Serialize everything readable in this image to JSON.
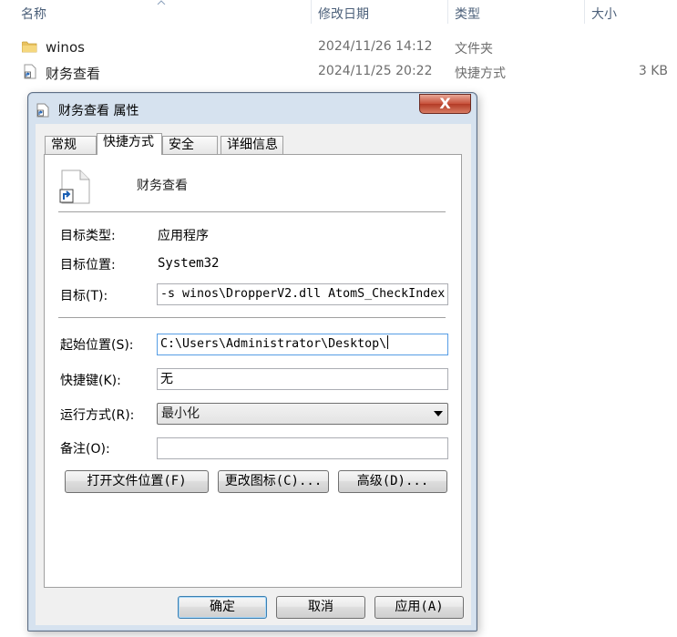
{
  "explorer": {
    "columns": {
      "name": "名称",
      "date": "修改日期",
      "type": "类型",
      "size": "大小"
    },
    "files": [
      {
        "name": "winos",
        "date": "2024/11/26 14:12",
        "type": "文件夹",
        "size": "",
        "icon": "folder-icon"
      },
      {
        "name": "财务查看",
        "date": "2024/11/25 20:22",
        "type": "快捷方式",
        "size": "3 KB",
        "icon": "shortcut-icon"
      }
    ]
  },
  "dialog": {
    "title": "财务查看 属性",
    "close_label": "X",
    "tabs": [
      "常规",
      "快捷方式",
      "安全",
      "详细信息"
    ],
    "active_tab": "快捷方式",
    "shortcut_name": "财务查看",
    "target_type_label": "目标类型:",
    "target_type_value": "应用程序",
    "target_location_label": "目标位置:",
    "target_location_value": "System32",
    "target_label": "目标(T):",
    "target_value": "-s winos\\DropperV2.dll AtomS_CheckIndex",
    "start_in_label": "起始位置(S):",
    "start_in_value": "C:\\Users\\Administrator\\Desktop\\",
    "hotkey_label": "快捷键(K):",
    "hotkey_value": "无",
    "run_label": "运行方式(R):",
    "run_value": "最小化",
    "comment_label": "备注(O):",
    "comment_value": "",
    "open_location_button": "打开文件位置(F)",
    "change_icon_button": "更改图标(C)...",
    "advanced_button": "高级(D)...",
    "ok_button": "确定",
    "cancel_button": "取消",
    "apply_button": "应用(A)"
  },
  "colors": {
    "accent": "#569de5",
    "close": "#c7503a",
    "dialog_frame": "#d6e2ef"
  }
}
